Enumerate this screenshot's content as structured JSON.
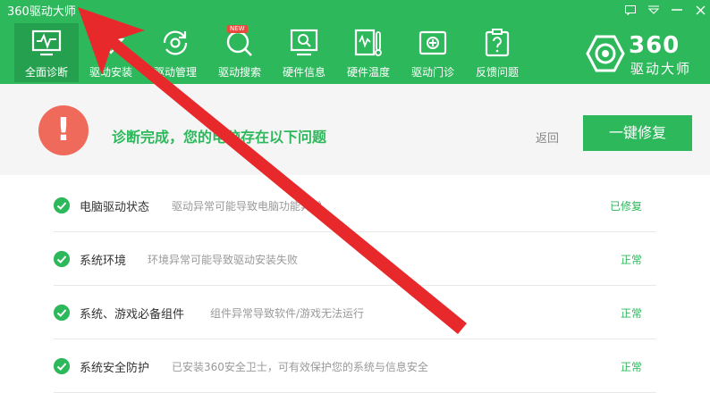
{
  "app": {
    "title": "360驱动大师"
  },
  "nav": [
    {
      "label": "全面诊断",
      "icon": "monitor-pulse-icon",
      "active": true
    },
    {
      "label": "驱动安装",
      "icon": "driver-install-icon"
    },
    {
      "label": "驱动管理",
      "icon": "refresh-gear-icon"
    },
    {
      "label": "驱动搜索",
      "icon": "search-icon",
      "badge": "NEW"
    },
    {
      "label": "硬件信息",
      "icon": "hardware-info-icon"
    },
    {
      "label": "硬件温度",
      "icon": "thermometer-icon"
    },
    {
      "label": "驱动门诊",
      "icon": "clinic-icon"
    },
    {
      "label": "反馈问题",
      "icon": "feedback-question-icon"
    }
  ],
  "brand": {
    "num": "360",
    "cn": "驱动大师"
  },
  "hero": {
    "message": "诊断完成，您的电脑存在以下问题",
    "back": "返回",
    "fix_button": "一键修复"
  },
  "rows": [
    {
      "title": "电脑驱动状态",
      "desc": "驱动异常可能导致电脑功能异常",
      "status": "已修复"
    },
    {
      "title": "系统环境",
      "desc": "环境异常可能导致驱动安装失败",
      "status": "正常"
    },
    {
      "title": "系统、游戏必备组件",
      "desc": "组件异常导致软件/游戏无法运行",
      "status": "正常"
    },
    {
      "title": "系统安全防护",
      "desc": "已安装360安全卫士，可有效保护您的系统与信息安全",
      "status": "正常"
    }
  ],
  "colors": {
    "green": "#2db85c",
    "red": "#f06a5b",
    "arrow": "#e8292b"
  }
}
